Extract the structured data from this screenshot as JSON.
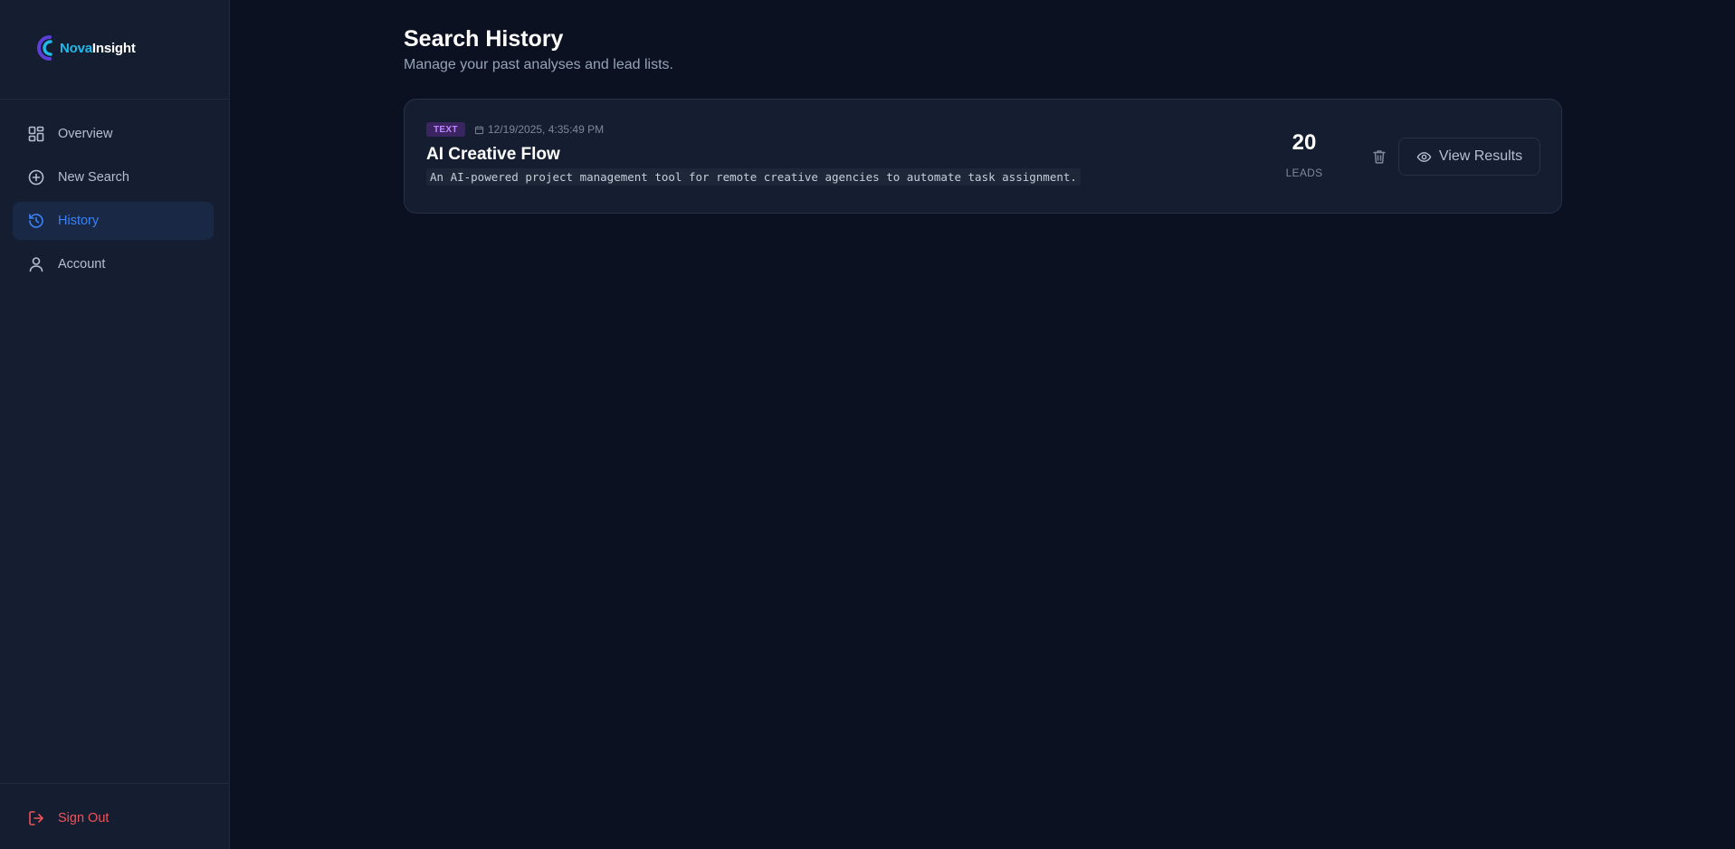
{
  "brand": {
    "name_part1": "Nova",
    "name_part2": "Insight",
    "primary": "#22b8e8"
  },
  "sidebar": {
    "items": [
      {
        "label": "Overview",
        "icon": "layout-grid-icon",
        "active": false
      },
      {
        "label": "New Search",
        "icon": "plus-circle-icon",
        "active": false
      },
      {
        "label": "History",
        "icon": "history-icon",
        "active": true
      },
      {
        "label": "Account",
        "icon": "user-icon",
        "active": false
      }
    ],
    "signout_label": "Sign Out"
  },
  "page": {
    "title": "Search History",
    "subtitle": "Manage your past analyses and lead lists."
  },
  "history": [
    {
      "type_badge": "TEXT",
      "date": "12/19/2025, 4:35:49 PM",
      "title": "AI Creative Flow",
      "description": "An AI-powered project management tool for remote creative agencies to automate task assignment.",
      "leads_count": "20",
      "leads_label": "LEADS",
      "view_label": "View Results"
    }
  ],
  "colors": {
    "background": "#0b1120",
    "sidebar": "#151e30",
    "active_nav": "#3b82f6",
    "danger": "#f0525a",
    "badge_text": "#c084fc"
  }
}
